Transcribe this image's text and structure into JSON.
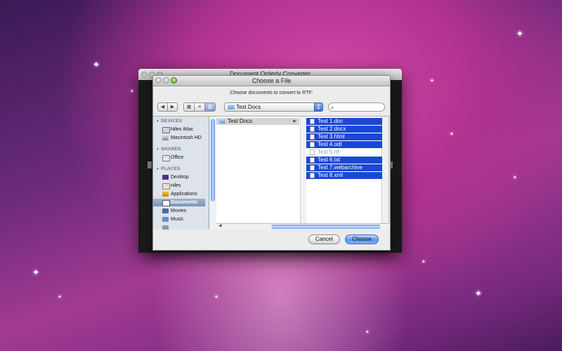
{
  "background_window": {
    "title": "Document Orderly Converter"
  },
  "dialog": {
    "title": "Choose a File",
    "prompt": "Choose documents to convert to RTF:",
    "path": {
      "current_folder": "Test Docs"
    },
    "search": {
      "placeholder": ""
    },
    "sidebar": {
      "sections": [
        {
          "header": "DEVICES",
          "items": [
            {
              "label": "Niles iMac",
              "icon": "imac-icon"
            },
            {
              "label": "Macintosh HD",
              "icon": "hard-drive-icon"
            }
          ]
        },
        {
          "header": "SHARED",
          "items": [
            {
              "label": "Office",
              "icon": "network-computer-icon"
            }
          ]
        },
        {
          "header": "PLACES",
          "items": [
            {
              "label": "Desktop",
              "icon": "desktop-folder-icon"
            },
            {
              "label": "niles",
              "icon": "home-icon"
            },
            {
              "label": "Applications",
              "icon": "applications-icon"
            },
            {
              "label": "Documents",
              "icon": "documents-folder-icon",
              "selected": true
            },
            {
              "label": "Movies",
              "icon": "movies-folder-icon"
            },
            {
              "label": "Music",
              "icon": "music-folder-icon"
            }
          ]
        }
      ]
    },
    "column1": [
      {
        "label": "Test Docs",
        "icon": "folder-icon",
        "selected": true,
        "has_children": true
      }
    ],
    "column2": [
      {
        "label": "Test 1.doc",
        "selected": true
      },
      {
        "label": "Test 2.docx",
        "selected": true
      },
      {
        "label": "Test 3.html",
        "selected": true
      },
      {
        "label": "Test 4.odt",
        "selected": true
      },
      {
        "label": "Test 5.rtf",
        "selected": false,
        "disabled": true
      },
      {
        "label": "Test 6.txt",
        "selected": true
      },
      {
        "label": "Test 7.webarchive",
        "selected": true
      },
      {
        "label": "Test 8.xml",
        "selected": true
      }
    ],
    "buttons": {
      "cancel": "Cancel",
      "choose": "Choose"
    },
    "colors": {
      "selection": "#1a48d4",
      "sidebar_bg": "#dde3ea",
      "accent_button": "#5d92ea"
    }
  }
}
